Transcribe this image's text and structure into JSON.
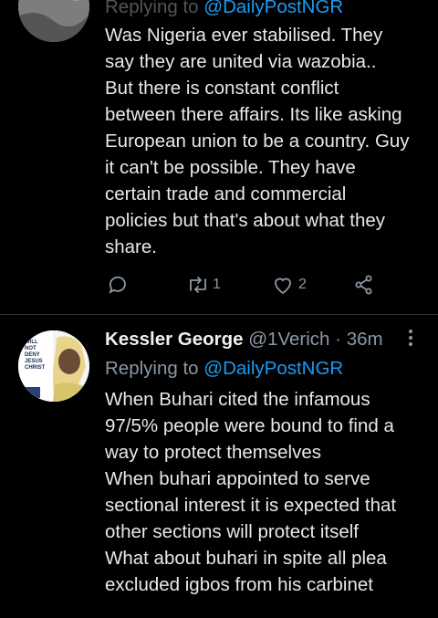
{
  "tweets": [
    {
      "reply_prefix": "Replying to",
      "reply_handle": "@DailyPostNGR",
      "body": "Was Nigeria ever stabilised. They\nsay they are united via wazobia..\nBut there is constant conflict\nbetween there affairs. Its like asking\nEuropean union to be a country. Guy\nit can't be possible. They have\ncertain trade and commercial\npolicies but that's about what they\nshare.",
      "retweet_count": "1",
      "like_count": "2",
      "icons": [
        "comment-icon",
        "retweet-icon",
        "like-icon",
        "share-icon"
      ]
    },
    {
      "name": "Kessler George",
      "handle": "@1Verich",
      "separator": "·",
      "time": "36m",
      "reply_prefix": "Replying to",
      "reply_handle": "@DailyPostNGR",
      "avatar_text": "WILL NOT DENY JESUS CHRIST",
      "body": "When Buhari cited the infamous\n97/5% people were bound to find a\nway to protect themselves\nWhen buhari appointed to serve\nsectional interest it is expected that\nother sections will protect itself\nWhat about buhari in spite all plea\nexcluded igbos from his carbinet"
    }
  ],
  "colors": {
    "background": "#000000",
    "text": "#e8e8e8",
    "secondary": "#8b98a5",
    "accent": "#1d9bf0",
    "divider": "#2f3336"
  }
}
